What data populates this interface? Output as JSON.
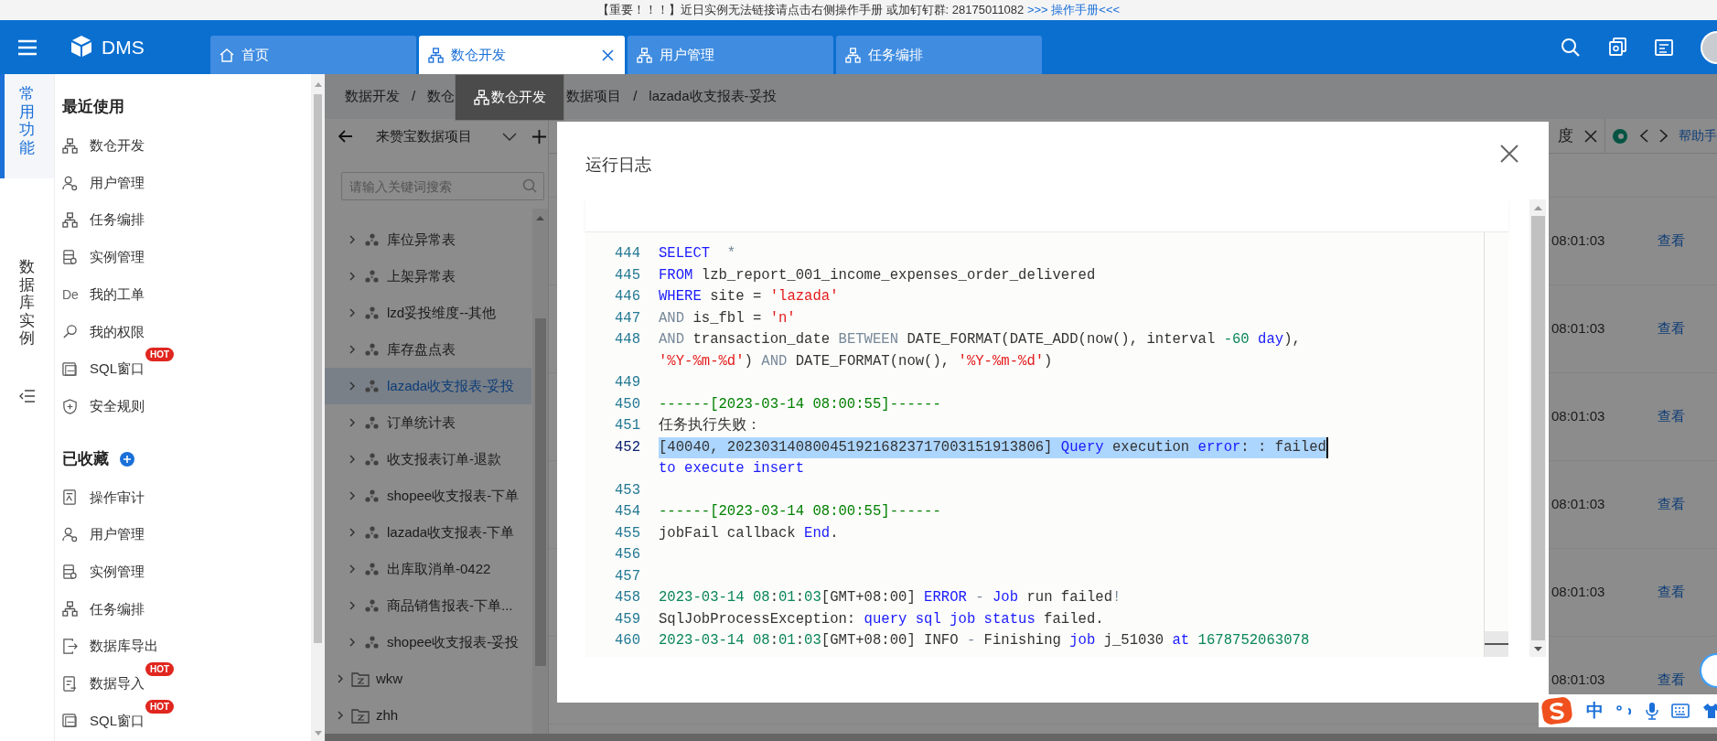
{
  "notice": {
    "text": "【重要！！！】近日实例无法链接请点击右侧操作手册 或加钉钉群: 28175011082 ",
    "link": ">>> 操作手册<<<"
  },
  "header": {
    "logo": "DMS",
    "tabs": [
      {
        "label": "首页",
        "selected": false,
        "kind": "home"
      },
      {
        "label": "数仓开发",
        "selected": true,
        "kind": "module"
      },
      {
        "label": "用户管理",
        "selected": false,
        "kind": "module"
      },
      {
        "label": "任务编排",
        "selected": false,
        "kind": "module"
      }
    ]
  },
  "rail": [
    {
      "label": "常用功能",
      "selected": true
    },
    {
      "label": "数据库实例",
      "selected": false
    }
  ],
  "sidebar": {
    "sections": [
      {
        "title": "最近使用",
        "items": [
          {
            "label": "数仓开发"
          },
          {
            "label": "用户管理"
          },
          {
            "label": "任务编排"
          },
          {
            "label": "实例管理"
          },
          {
            "label": "我的工单",
            "icon_text": "De"
          },
          {
            "label": "我的权限"
          },
          {
            "label": "SQL窗口",
            "badge": "HOT"
          },
          {
            "label": "安全规则"
          }
        ]
      },
      {
        "title": "已收藏",
        "add": true,
        "items": [
          {
            "label": "操作审计"
          },
          {
            "label": "用户管理"
          },
          {
            "label": "实例管理"
          },
          {
            "label": "任务编排"
          },
          {
            "label": "数据库导出"
          },
          {
            "label": "数据导入",
            "badge": "HOT"
          },
          {
            "label": "SQL窗口",
            "badge": "HOT"
          }
        ]
      }
    ]
  },
  "breadcrumb": [
    {
      "label": "数据开发",
      "separator": "/"
    },
    {
      "label": "数仓"
    },
    {
      "label": "数据项目",
      "separator": "/"
    },
    {
      "label": "lazada收支报表-妥投"
    }
  ],
  "tooltip": "数仓开发",
  "tree": {
    "project": "来赞宝数据项目",
    "search_placeholder": "请输入关键词搜索",
    "items": [
      {
        "children": [
          {
            "label": "库位异常表",
            "selected": false,
            "expanded": false
          },
          {
            "label": "上架异常表",
            "selected": false,
            "expanded": false
          },
          {
            "label": "lzd妥投维度--其他",
            "selected": false,
            "expanded": false
          },
          {
            "label": "库存盘点表",
            "selected": false,
            "expanded": false
          },
          {
            "label": "lazada收支报表-妥投",
            "selected": true,
            "expanded": false
          },
          {
            "label": "订单统计表",
            "selected": false,
            "expanded": false
          },
          {
            "label": "收支报表订单-退款",
            "selected": false,
            "expanded": false
          },
          {
            "label": "shopee收支报表-下单",
            "selected": false,
            "expanded": false
          },
          {
            "label": "lazada收支报表-下单",
            "selected": false,
            "expanded": false
          },
          {
            "label": "出库取消单-0422",
            "selected": false,
            "expanded": false
          },
          {
            "label": "商品销售报表-下单...",
            "selected": false,
            "expanded": false
          },
          {
            "label": "shopee收支报表-妥投",
            "selected": false,
            "expanded": false
          }
        ]
      },
      {
        "label": "wkw",
        "selected": false,
        "expanded": false
      },
      {
        "label": "zhh",
        "selected": false,
        "expanded": false
      }
    ]
  },
  "content": {
    "tab": "度",
    "help": "帮助手",
    "rows": [
      {
        "time": "08:01:03",
        "action": "查看"
      },
      {
        "time": "08:01:03",
        "action": "查看"
      },
      {
        "time": "08:01:03",
        "action": "查看"
      },
      {
        "time": "08:01:03",
        "action": "查看"
      },
      {
        "time": "08:01:03",
        "action": "查看"
      },
      {
        "time": "08:01:03",
        "action": "查看"
      }
    ]
  },
  "modal": {
    "title": "运行日志",
    "lines": [
      {
        "number": "444",
        "rows": [
          {
            "highlighted": false,
            "tokens": [
              {
                "text": "SELECT",
                "kind": "keyword"
              },
              {
                "text": "  *",
                "kind": "operator"
              }
            ]
          }
        ]
      },
      {
        "number": "445",
        "rows": [
          {
            "highlighted": false,
            "tokens": [
              {
                "text": "FROM",
                "kind": "keyword"
              },
              {
                "text": " lzb_report_001_income_expenses_order_delivered",
                "kind": "plain"
              }
            ]
          }
        ]
      },
      {
        "number": "446",
        "rows": [
          {
            "highlighted": false,
            "tokens": [
              {
                "text": "WHERE",
                "kind": "keyword"
              },
              {
                "text": " site = ",
                "kind": "plain"
              },
              {
                "text": "'lazada'",
                "kind": "string"
              }
            ]
          }
        ]
      },
      {
        "number": "447",
        "rows": [
          {
            "highlighted": false,
            "tokens": [
              {
                "text": "AND",
                "kind": "operator"
              },
              {
                "text": " is_fbl = ",
                "kind": "plain"
              },
              {
                "text": "'n'",
                "kind": "string"
              }
            ]
          }
        ]
      },
      {
        "number": "448",
        "rows": [
          {
            "highlighted": false,
            "tokens": [
              {
                "text": "AND",
                "kind": "operator"
              },
              {
                "text": " transaction_date ",
                "kind": "plain"
              },
              {
                "text": "BETWEEN",
                "kind": "operator"
              },
              {
                "text": " DATE_FORMAT(DATE_ADD(now(), interval ",
                "kind": "plain"
              },
              {
                "text": "-60",
                "kind": "number"
              },
              {
                "text": " day",
                "kind": "keyword"
              },
              {
                "text": "),",
                "kind": "plain"
              }
            ]
          },
          {
            "highlighted": false,
            "tokens": [
              {
                "text": "'%Y-%m-%d'",
                "kind": "string"
              },
              {
                "text": ") ",
                "kind": "plain"
              },
              {
                "text": "AND",
                "kind": "operator"
              },
              {
                "text": " DATE_FORMAT(now(), ",
                "kind": "plain"
              },
              {
                "text": "'%Y-%m-%d'",
                "kind": "string"
              },
              {
                "text": ")",
                "kind": "plain"
              }
            ]
          }
        ]
      },
      {
        "number": "449"
      },
      {
        "number": "450",
        "rows": [
          {
            "highlighted": false,
            "tokens": [
              {
                "text": "------[2023-03-14 08:00:55]------",
                "kind": "comment"
              }
            ]
          }
        ]
      },
      {
        "number": "451",
        "rows": [
          {
            "highlighted": false,
            "tokens": [
              {
                "text": "任务执行失败：",
                "kind": "plain"
              }
            ]
          }
        ]
      },
      {
        "number": "452",
        "rows": [
          {
            "highlighted": true,
            "tokens": [
              {
                "text": "[40040, 2023031408004519216823717003151913806] ",
                "kind": "plain"
              },
              {
                "text": "Query",
                "kind": "keyword"
              },
              {
                "text": " execution ",
                "kind": "plain"
              },
              {
                "text": "error",
                "kind": "keyword"
              },
              {
                "text": ": : failed",
                "kind": "plain"
              }
            ]
          },
          {
            "highlighted": false,
            "tokens": [
              {
                "text": "to execute insert",
                "kind": "keyword"
              }
            ]
          }
        ]
      },
      {
        "number": "453"
      },
      {
        "number": "454",
        "rows": [
          {
            "highlighted": false,
            "tokens": [
              {
                "text": "------[2023-03-14 08:00:55]------",
                "kind": "comment"
              }
            ]
          }
        ]
      },
      {
        "number": "455",
        "rows": [
          {
            "highlighted": false,
            "tokens": [
              {
                "text": "jobFail callback ",
                "kind": "plain"
              },
              {
                "text": "End",
                "kind": "keyword"
              },
              {
                "text": ".",
                "kind": "plain"
              }
            ]
          }
        ]
      },
      {
        "number": "456"
      },
      {
        "number": "457"
      },
      {
        "number": "458",
        "rows": [
          {
            "highlighted": false,
            "tokens": [
              {
                "text": "2023-03-14 08",
                "kind": "number"
              },
              {
                "text": ":",
                "kind": "plain"
              },
              {
                "text": "01",
                "kind": "number"
              },
              {
                "text": ":",
                "kind": "plain"
              },
              {
                "text": "03",
                "kind": "number"
              },
              {
                "text": "[GMT+08:00] ",
                "kind": "plain"
              },
              {
                "text": "ERROR",
                "kind": "keyword"
              },
              {
                "text": " - ",
                "kind": "operator"
              },
              {
                "text": "Job",
                "kind": "keyword"
              },
              {
                "text": " run failed",
                "kind": "plain"
              },
              {
                "text": "!",
                "kind": "operator"
              }
            ]
          }
        ]
      },
      {
        "number": "459",
        "rows": [
          {
            "highlighted": false,
            "tokens": [
              {
                "text": "SqlJobProcessException: ",
                "kind": "plain"
              },
              {
                "text": "query sql job status",
                "kind": "keyword"
              },
              {
                "text": " failed.",
                "kind": "plain"
              }
            ]
          }
        ]
      },
      {
        "number": "460",
        "rows": [
          {
            "highlighted": false,
            "tokens": [
              {
                "text": "2023-03-14 08",
                "kind": "number"
              },
              {
                "text": ":",
                "kind": "plain"
              },
              {
                "text": "01",
                "kind": "number"
              },
              {
                "text": ":",
                "kind": "plain"
              },
              {
                "text": "03",
                "kind": "number"
              },
              {
                "text": "[GMT+08:00] INFO ",
                "kind": "plain"
              },
              {
                "text": "-",
                "kind": "operator"
              },
              {
                "text": " Finishing ",
                "kind": "plain"
              },
              {
                "text": "job",
                "kind": "keyword"
              },
              {
                "text": " j_51030 ",
                "kind": "plain"
              },
              {
                "text": "at",
                "kind": "keyword"
              },
              {
                "text": " 1678752063078",
                "kind": "number"
              }
            ]
          }
        ]
      }
    ]
  },
  "ime": {
    "mode": "中"
  }
}
